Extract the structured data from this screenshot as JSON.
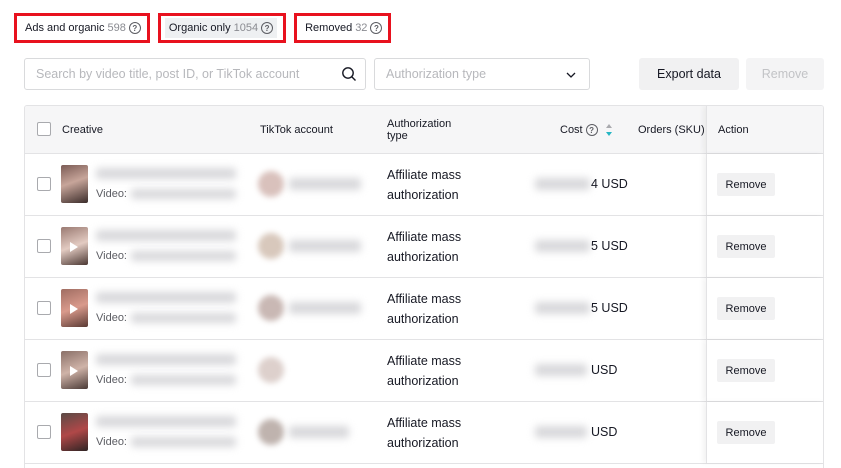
{
  "tabs": [
    {
      "label": "Ads and organic",
      "count": "598"
    },
    {
      "label": "Organic only",
      "count": "1054"
    },
    {
      "label": "Removed",
      "count": "32"
    }
  ],
  "search": {
    "placeholder": "Search by video title, post ID, or TikTok account"
  },
  "auth_select": {
    "placeholder": "Authorization type"
  },
  "buttons": {
    "export": "Export data",
    "remove": "Remove"
  },
  "table": {
    "headers": {
      "creative": "Creative",
      "account": "TikTok account",
      "auth_line1": "Authorization",
      "auth_line2": "type",
      "cost": "Cost",
      "orders": "Orders (SKU)",
      "action": "Action"
    },
    "rows": [
      {
        "video_label": "Video:",
        "auth_line1": "Affiliate mass",
        "auth_line2": "authorization",
        "cost_suffix": "4 USD",
        "action": "Remove"
      },
      {
        "video_label": "Video:",
        "auth_line1": "Affiliate mass",
        "auth_line2": "authorization",
        "cost_suffix": "5 USD",
        "action": "Remove"
      },
      {
        "video_label": "Video:",
        "auth_line1": "Affiliate mass",
        "auth_line2": "authorization",
        "cost_suffix": "5 USD",
        "action": "Remove"
      },
      {
        "video_label": "Video:",
        "auth_line1": "Affiliate mass",
        "auth_line2": "authorization",
        "cost_suffix": "USD",
        "action": "Remove"
      },
      {
        "video_label": "Video:",
        "auth_line1": "Affiliate mass",
        "auth_line2": "authorization",
        "cost_suffix": "USD",
        "action": "Remove"
      }
    ]
  }
}
